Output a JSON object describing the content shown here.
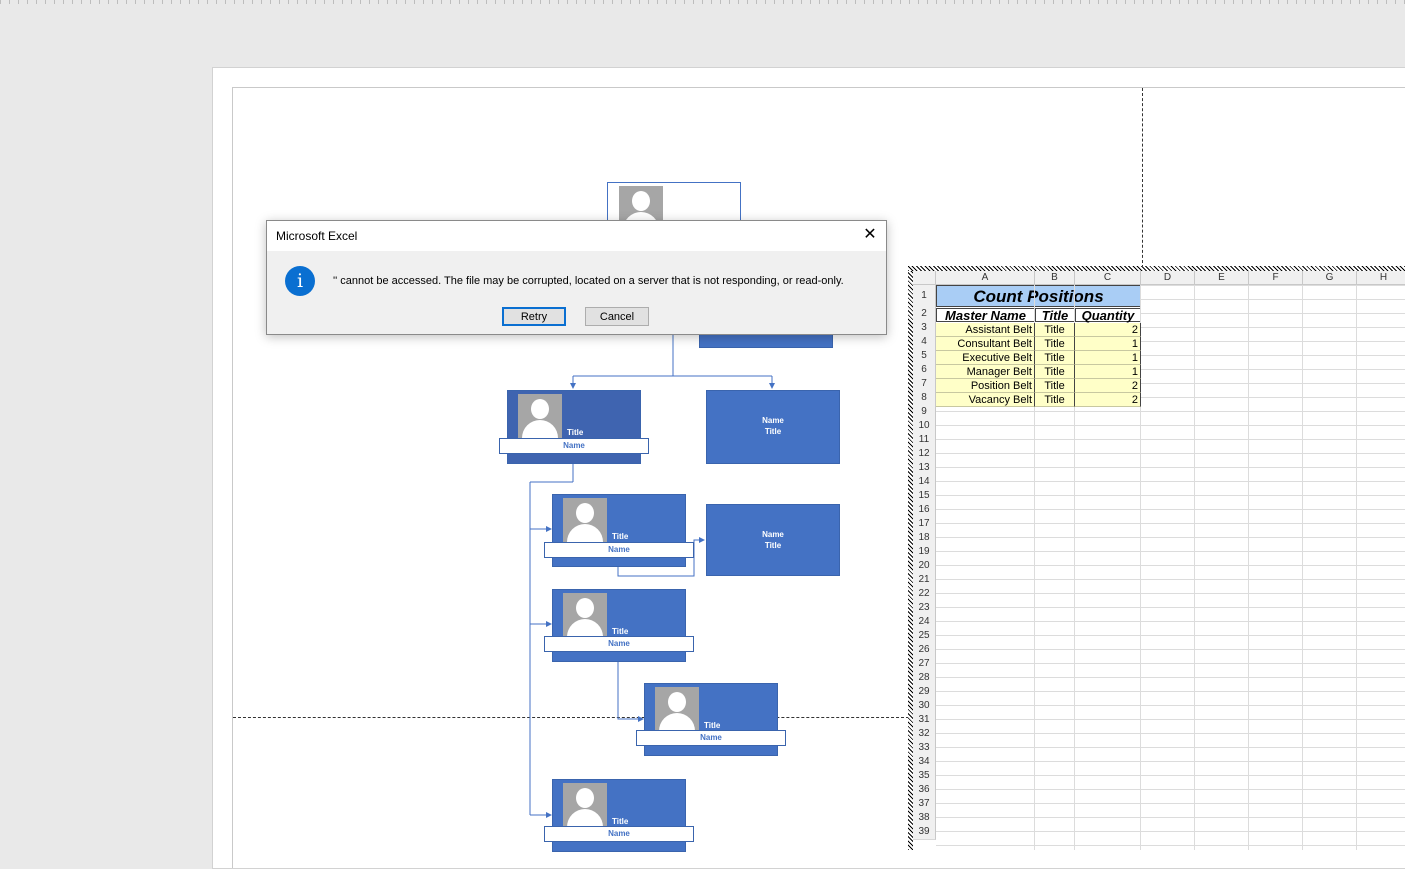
{
  "dialog": {
    "title": "Microsoft Excel",
    "message": "'' cannot be accessed. The file may be corrupted, located on a server that is not responding, or read-only.",
    "retry_label": "Retry",
    "cancel_label": "Cancel",
    "close_glyph": "✕",
    "info_glyph": "i",
    "accent": "#0a6fd1"
  },
  "org_chart": {
    "accent": "#4472c4",
    "cards": [
      {
        "title": "Title",
        "name": "Name"
      },
      {
        "title": "Title",
        "name": "Name"
      },
      {
        "title": "Title",
        "name": "Name"
      },
      {
        "title": "Title",
        "name": "Name"
      },
      {
        "title": "Title",
        "name": "Name"
      }
    ],
    "text_cards": [
      {
        "name": "Name",
        "title": "Title"
      },
      {
        "name": "Name",
        "title": "Title"
      }
    ]
  },
  "sheet": {
    "columns": [
      "A",
      "B",
      "C",
      "D",
      "E",
      "F",
      "G",
      "H"
    ],
    "rows": [
      "1",
      "2",
      "3",
      "4",
      "5",
      "6",
      "7",
      "8",
      "9",
      "10",
      "11",
      "12",
      "13",
      "14",
      "15",
      "16",
      "17",
      "18",
      "19",
      "20",
      "21",
      "22",
      "23",
      "24",
      "25",
      "26",
      "27",
      "28",
      "29",
      "30",
      "31",
      "32",
      "33",
      "34",
      "35",
      "36",
      "37",
      "38",
      "39"
    ],
    "title": "Count Positions",
    "headers": [
      "Master Name",
      "Title",
      "Quantity"
    ],
    "data": [
      [
        "Assistant Belt",
        "Title",
        "2"
      ],
      [
        "Consultant Belt",
        "Title",
        "1"
      ],
      [
        "Executive Belt",
        "Title",
        "1"
      ],
      [
        "Manager Belt",
        "Title",
        "1"
      ],
      [
        "Position Belt",
        "Title",
        "2"
      ],
      [
        "Vacancy Belt",
        "Title",
        "2"
      ]
    ],
    "title_fill": "#a9cdf5",
    "data_fill": "#ffffc8"
  }
}
